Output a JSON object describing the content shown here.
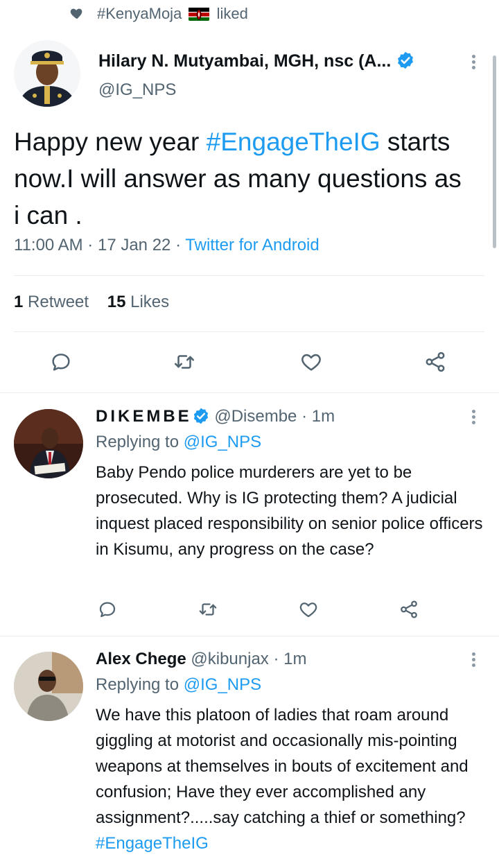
{
  "liked": {
    "hashtag": "#KenyaMoja",
    "suffix": "liked"
  },
  "main_tweet": {
    "name": "Hilary N. Mutyambai, MGH, nsc (A...",
    "handle": "@IG_NPS",
    "text_before": "Happy new year ",
    "hashtag": "#EngageTheIG",
    "text_after": " starts now.I will answer as many questions as i can .",
    "time": "11:00 AM",
    "date": "17 Jan 22",
    "client": "Twitter for Android",
    "sep": "·",
    "retweet_count": "1",
    "retweet_label": "Retweet",
    "like_count": "15",
    "like_label": "Likes"
  },
  "replies": [
    {
      "name": "DIKEMBE",
      "handle": "@Disembe",
      "time": "1m",
      "replying_label": "Replying to",
      "replying_to": "@IG_NPS",
      "text": "Baby Pendo police murderers are yet to be prosecuted. Why is IG protecting them? A judicial inquest placed responsibility on senior police officers in Kisumu, any progress on the case?"
    },
    {
      "name": "Alex Chege",
      "handle": "@kibunjax",
      "time": "1m",
      "replying_label": "Replying to",
      "replying_to": "@IG_NPS",
      "text": "We have this platoon of ladies that roam around giggling at motorist and occasionally mis-pointing weapons at themselves in bouts of excitement and confusion; Have they ever accomplished any assignment?.....say catching a thief or something? ",
      "hashtag": "#EngageTheIG"
    }
  ],
  "colors": {
    "accent": "#1d9bf0",
    "secondary_text": "#536471",
    "primary_text": "#0f1419",
    "divider": "#e6ecf0"
  },
  "icons": [
    "heart-icon",
    "kenya-flag-icon",
    "verified-badge-icon",
    "more-icon",
    "reply-icon",
    "retweet-icon",
    "like-icon",
    "share-icon"
  ]
}
